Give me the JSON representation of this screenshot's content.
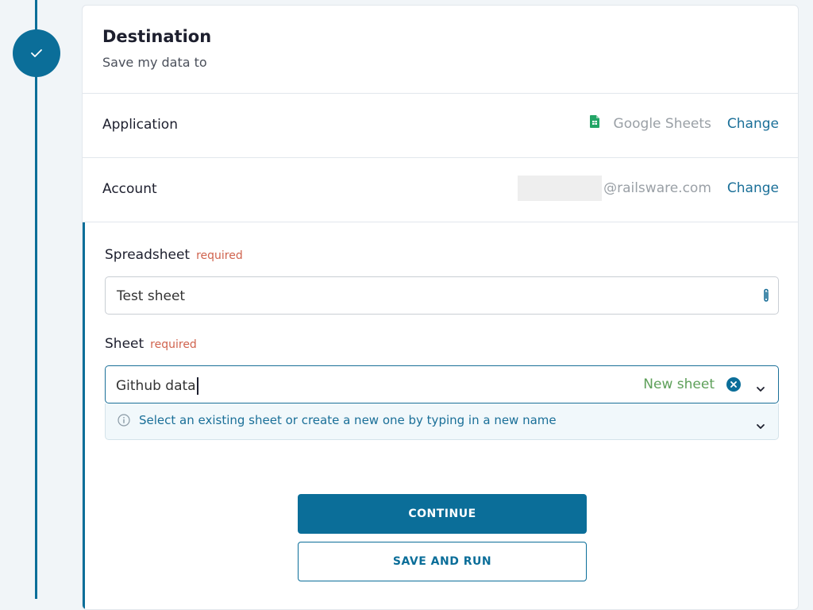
{
  "step": {
    "status_icon": "check-icon"
  },
  "destination": {
    "title": "Destination",
    "subtitle": "Save my data to"
  },
  "application": {
    "label": "Application",
    "value": "Google Sheets",
    "icon": "google-sheets-icon",
    "change_label": "Change"
  },
  "account": {
    "label": "Account",
    "value": "@railsware.com",
    "change_label": "Change"
  },
  "spreadsheet": {
    "label": "Spreadsheet",
    "required_label": "required",
    "value": "Test sheet",
    "icon": "paperclip-icon"
  },
  "sheet": {
    "label": "Sheet",
    "required_label": "required",
    "value": "Github data",
    "badge": "New sheet",
    "hint": "Select an existing sheet or create a new one by typing in a new name"
  },
  "actions": {
    "continue_label": "CONTINUE",
    "save_run_label": "SAVE AND RUN"
  },
  "colors": {
    "accent": "#0b6e99",
    "required": "#d0634e",
    "new_sheet": "#5ea05a"
  }
}
